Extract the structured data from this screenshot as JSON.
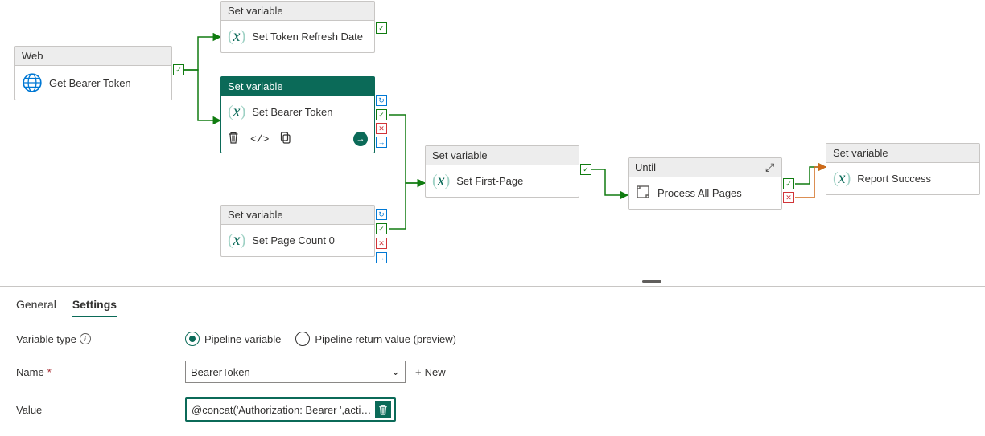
{
  "nodes": {
    "web": {
      "type": "Web",
      "title": "Get Bearer Token"
    },
    "sv_refresh": {
      "type": "Set variable",
      "title": "Set Token Refresh Date"
    },
    "sv_bearer": {
      "type": "Set variable",
      "title": "Set Bearer Token"
    },
    "sv_page0": {
      "type": "Set variable",
      "title": "Set Page Count 0"
    },
    "sv_first": {
      "type": "Set variable",
      "title": "Set First-Page"
    },
    "until": {
      "type": "Until",
      "title": "Process All Pages"
    },
    "sv_success": {
      "type": "Set variable",
      "title": "Report Success"
    }
  },
  "icons": {
    "check": "✓",
    "cross": "✕",
    "arrow": "→",
    "chevron": "⌄",
    "plus": "+"
  },
  "panel": {
    "tabs": {
      "general": "General",
      "settings": "Settings"
    },
    "labels": {
      "vartype": "Variable type",
      "name": "Name",
      "value": "Value",
      "new": "New"
    },
    "radios": {
      "pipeline": "Pipeline variable",
      "return": "Pipeline return value (preview)"
    },
    "name_value": "BearerToken",
    "value_expr": "@concat('Authorization: Bearer ',acti…"
  }
}
